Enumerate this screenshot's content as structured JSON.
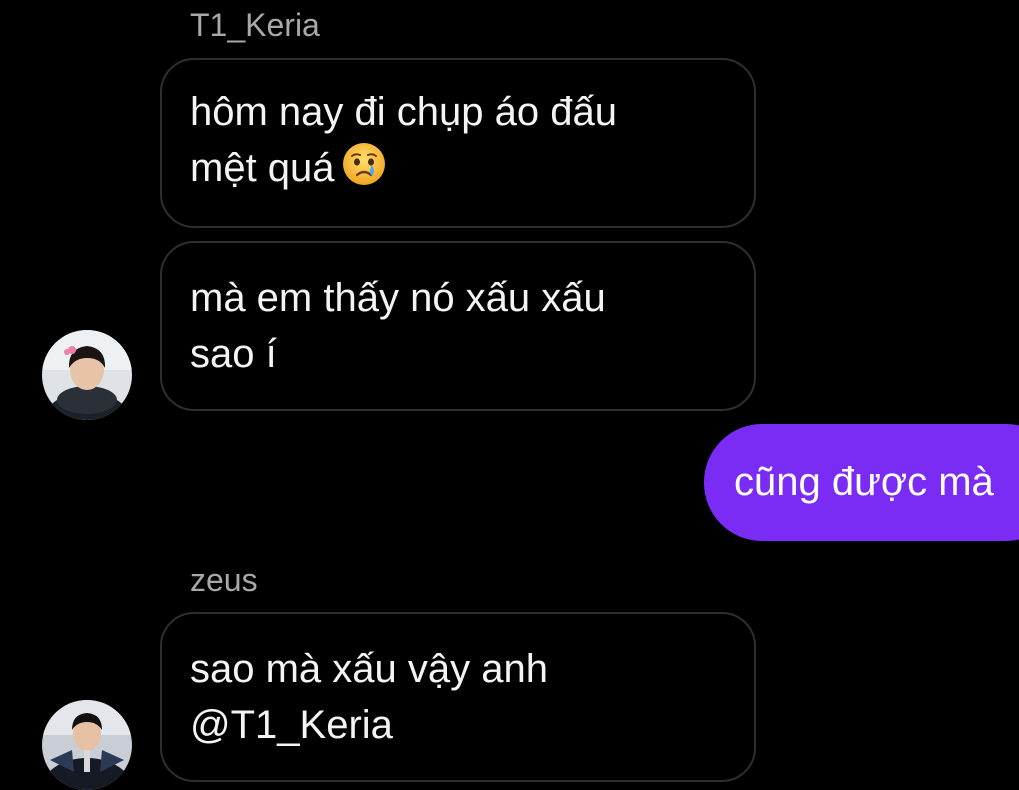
{
  "thread": {
    "groups": [
      {
        "sender": "T1_Keria",
        "messages": [
          {
            "lines": [
              "hôm nay đi chụp áo đấu",
              "mệt quá"
            ],
            "emoji": "crying-face-icon"
          },
          {
            "lines": [
              "mà em thấy nó xấu xấu",
              "sao í"
            ]
          }
        ]
      },
      {
        "sender": "zeus",
        "messages": [
          {
            "lines": [
              "sao mà xấu vậy anh",
              "@T1_Keria"
            ]
          }
        ]
      }
    ],
    "outgoing": [
      {
        "text": "cũng được mà"
      }
    ]
  },
  "colors": {
    "background": "#000000",
    "incoming_bubble_border": "#2f2f2f",
    "outgoing_bubble": "#7a2cf5",
    "sender_name": "#a8a8a8",
    "message_text": "#f4f4f4"
  }
}
